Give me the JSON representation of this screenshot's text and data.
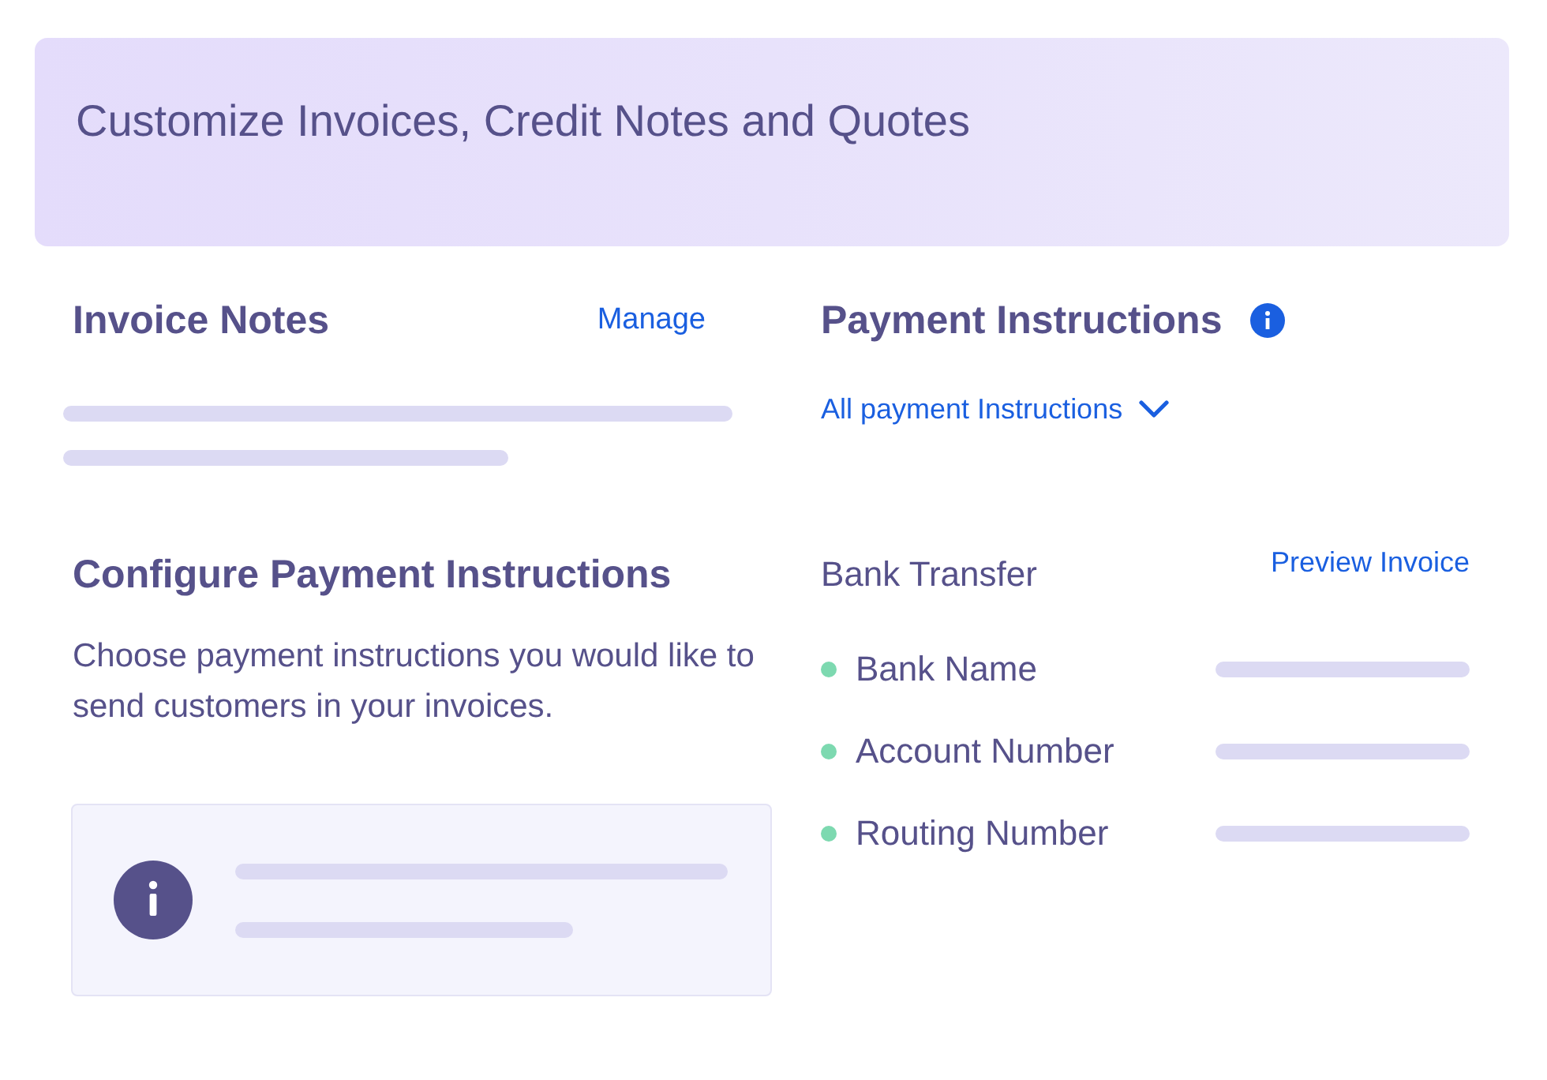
{
  "header": {
    "title": "Customize Invoices, Credit Notes and Quotes"
  },
  "invoice_notes": {
    "title": "Invoice Notes",
    "action": "Manage"
  },
  "payment_instructions": {
    "title": "Payment Instructions",
    "filter": "All payment Instructions"
  },
  "configure": {
    "title": "Configure Payment Instructions",
    "description": "Choose payment instructions you would like to send customers in your invoices."
  },
  "bank_transfer": {
    "title": "Bank Transfer",
    "action": "Preview Invoice",
    "fields": [
      {
        "label": "Bank Name"
      },
      {
        "label": "Account Number"
      },
      {
        "label": "Routing Number"
      }
    ]
  }
}
